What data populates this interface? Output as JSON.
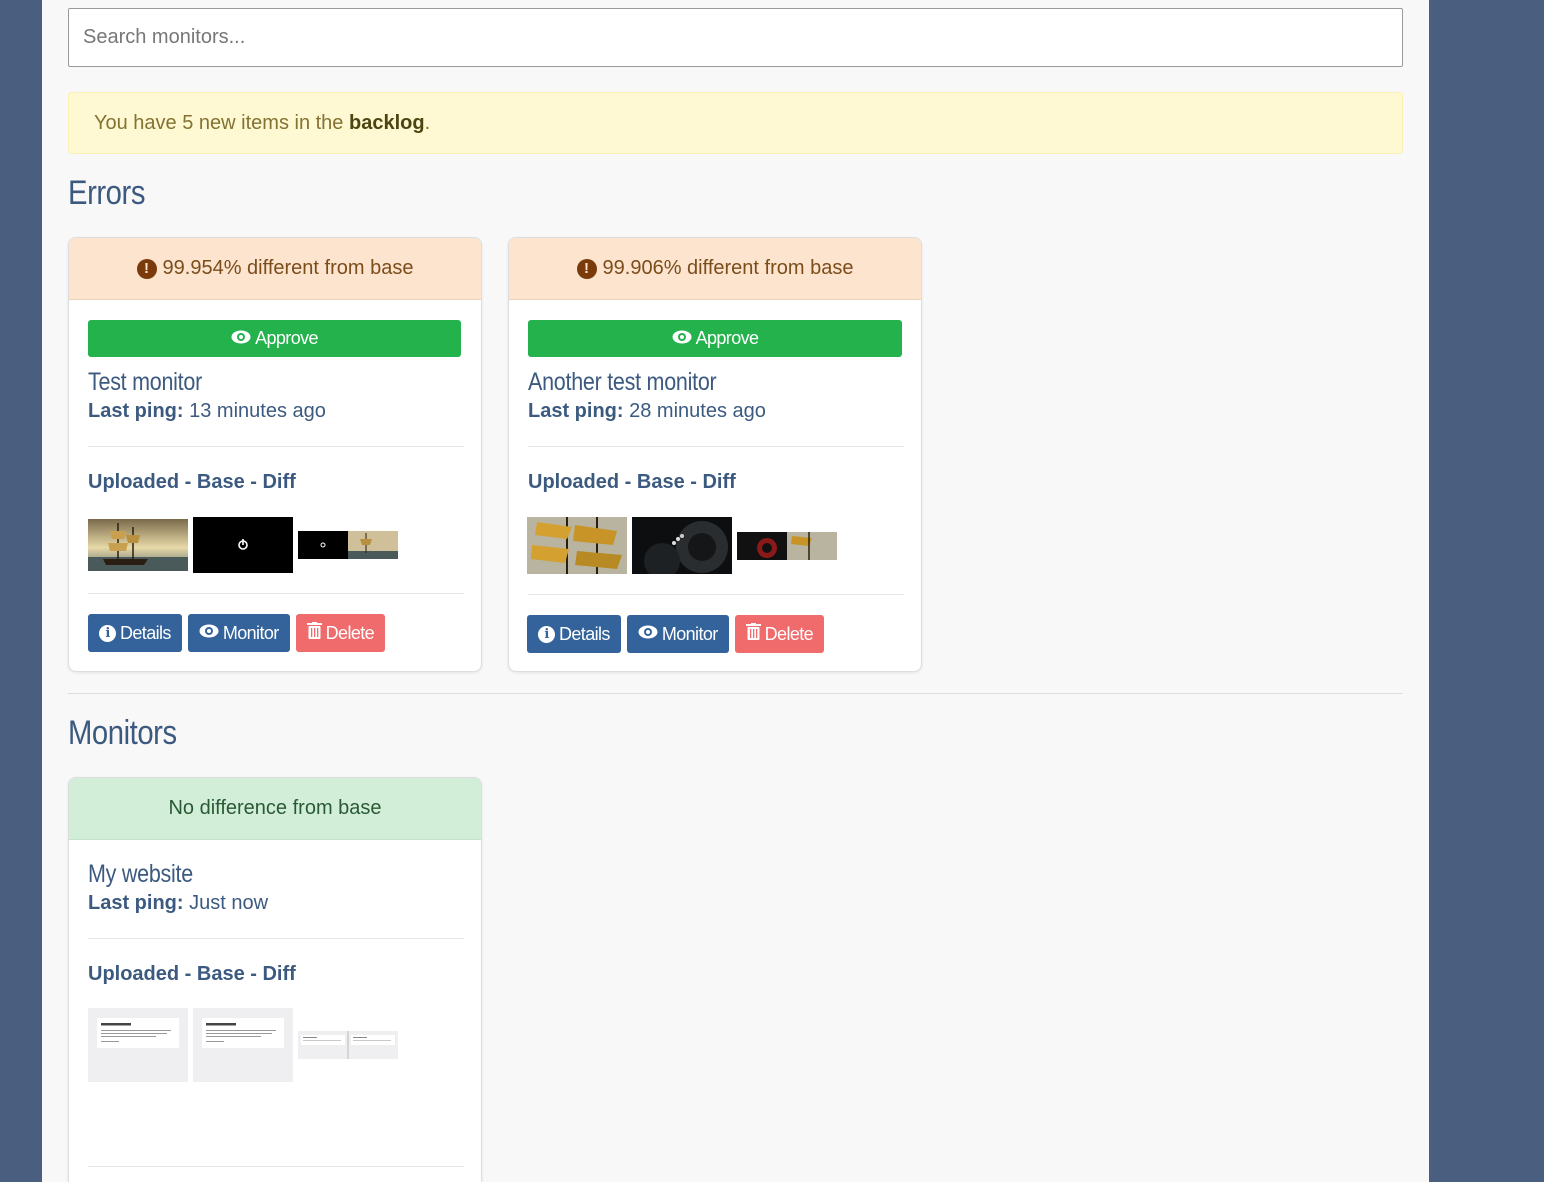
{
  "search": {
    "placeholder": "Search monitors..."
  },
  "alert": {
    "prefix": "You have 5 new items in the ",
    "link": "backlog",
    "suffix": "."
  },
  "sections": {
    "errors_title": "Errors",
    "monitors_title": "Monitors"
  },
  "labels": {
    "approve": "Approve",
    "last_ping": "Last ping:",
    "uploaded_base_diff": "Uploaded - Base - Diff",
    "details": "Details",
    "monitor": "Monitor",
    "delete": "Delete"
  },
  "errors": [
    {
      "status": "99.954% different from base",
      "name": "Test monitor",
      "last_ping": "13 minutes ago"
    },
    {
      "status": "99.906% different from base",
      "name": "Another test monitor",
      "last_ping": "28 minutes ago"
    }
  ],
  "monitors": [
    {
      "status": "No difference from base",
      "name": "My website",
      "last_ping": "Just now"
    }
  ],
  "colors": {
    "approve": "#24b24d",
    "primary": "#33639a",
    "danger": "#f06b6b",
    "error_head": "#fde4cf",
    "ok_head": "#d2eed9"
  }
}
